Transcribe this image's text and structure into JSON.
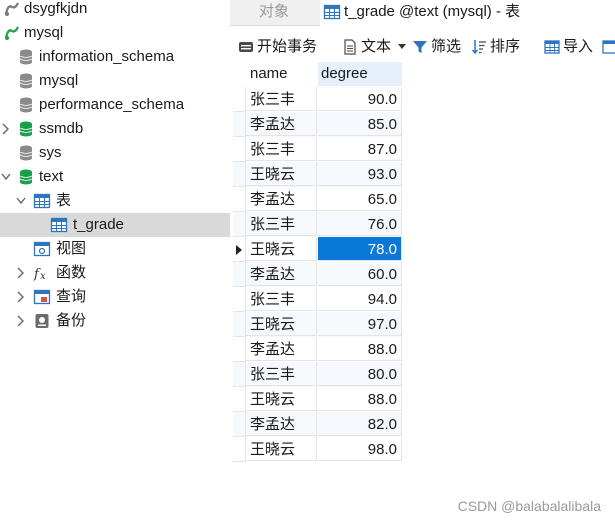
{
  "tree": {
    "connections": [
      {
        "label": "dsygfkjdn"
      },
      {
        "label": "mysql"
      }
    ],
    "databases": [
      {
        "label": "information_schema"
      },
      {
        "label": "mysql"
      },
      {
        "label": "performance_schema"
      },
      {
        "label": "ssmdb"
      },
      {
        "label": "sys"
      },
      {
        "label": "text"
      }
    ],
    "folders": {
      "tables": "表",
      "views": "视图",
      "functions": "函数",
      "queries": "查询",
      "backups": "备份"
    },
    "tables": [
      {
        "label": "t_grade"
      }
    ]
  },
  "tabs": {
    "objects": "对象",
    "table": "t_grade @text (mysql) - 表"
  },
  "toolbar": {
    "begin_transaction": "开始事务",
    "text": "文本",
    "filter": "筛选",
    "sort": "排序",
    "import": "导入"
  },
  "grid": {
    "columns": [
      "name",
      "degree"
    ],
    "rows": [
      [
        "张三丰",
        "90.0"
      ],
      [
        "李孟达",
        "85.0"
      ],
      [
        "张三丰",
        "87.0"
      ],
      [
        "王晓云",
        "93.0"
      ],
      [
        "李孟达",
        "65.0"
      ],
      [
        "张三丰",
        "76.0"
      ],
      [
        "王晓云",
        "78.0"
      ],
      [
        "李孟达",
        "60.0"
      ],
      [
        "张三丰",
        "94.0"
      ],
      [
        "王晓云",
        "97.0"
      ],
      [
        "李孟达",
        "88.0"
      ],
      [
        "张三丰",
        "80.0"
      ],
      [
        "王晓云",
        "88.0"
      ],
      [
        "李孟达",
        "82.0"
      ],
      [
        "王晓云",
        "98.0"
      ]
    ],
    "selected_row": 6
  },
  "watermark": "CSDN @balabalalibala",
  "colors": {
    "selection": "#0a78d7",
    "db_connected": "#1aa04a",
    "db_closed": "#8a8a8a",
    "tab_inactive_text": "#999999"
  }
}
